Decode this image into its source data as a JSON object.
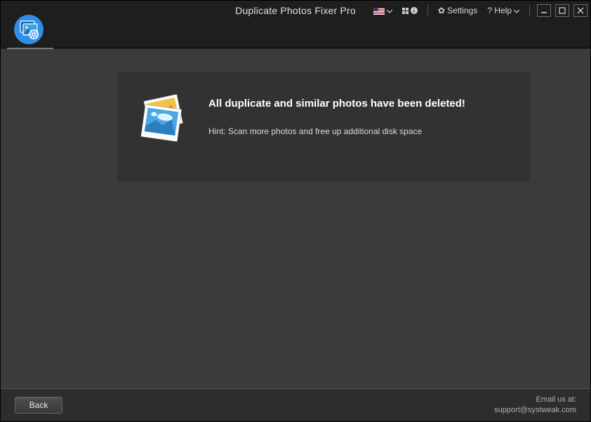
{
  "titlebar": {
    "app_title": "Duplicate Photos Fixer Pro",
    "settings_label": "Settings",
    "help_label": "? Help"
  },
  "result": {
    "heading": "All duplicate and similar photos have been deleted!",
    "hint": "Hint: Scan more photos and free up additional disk space"
  },
  "bottom": {
    "back_label": "Back",
    "email_label": "Email us at:",
    "email_address": "support@systweak.com"
  }
}
